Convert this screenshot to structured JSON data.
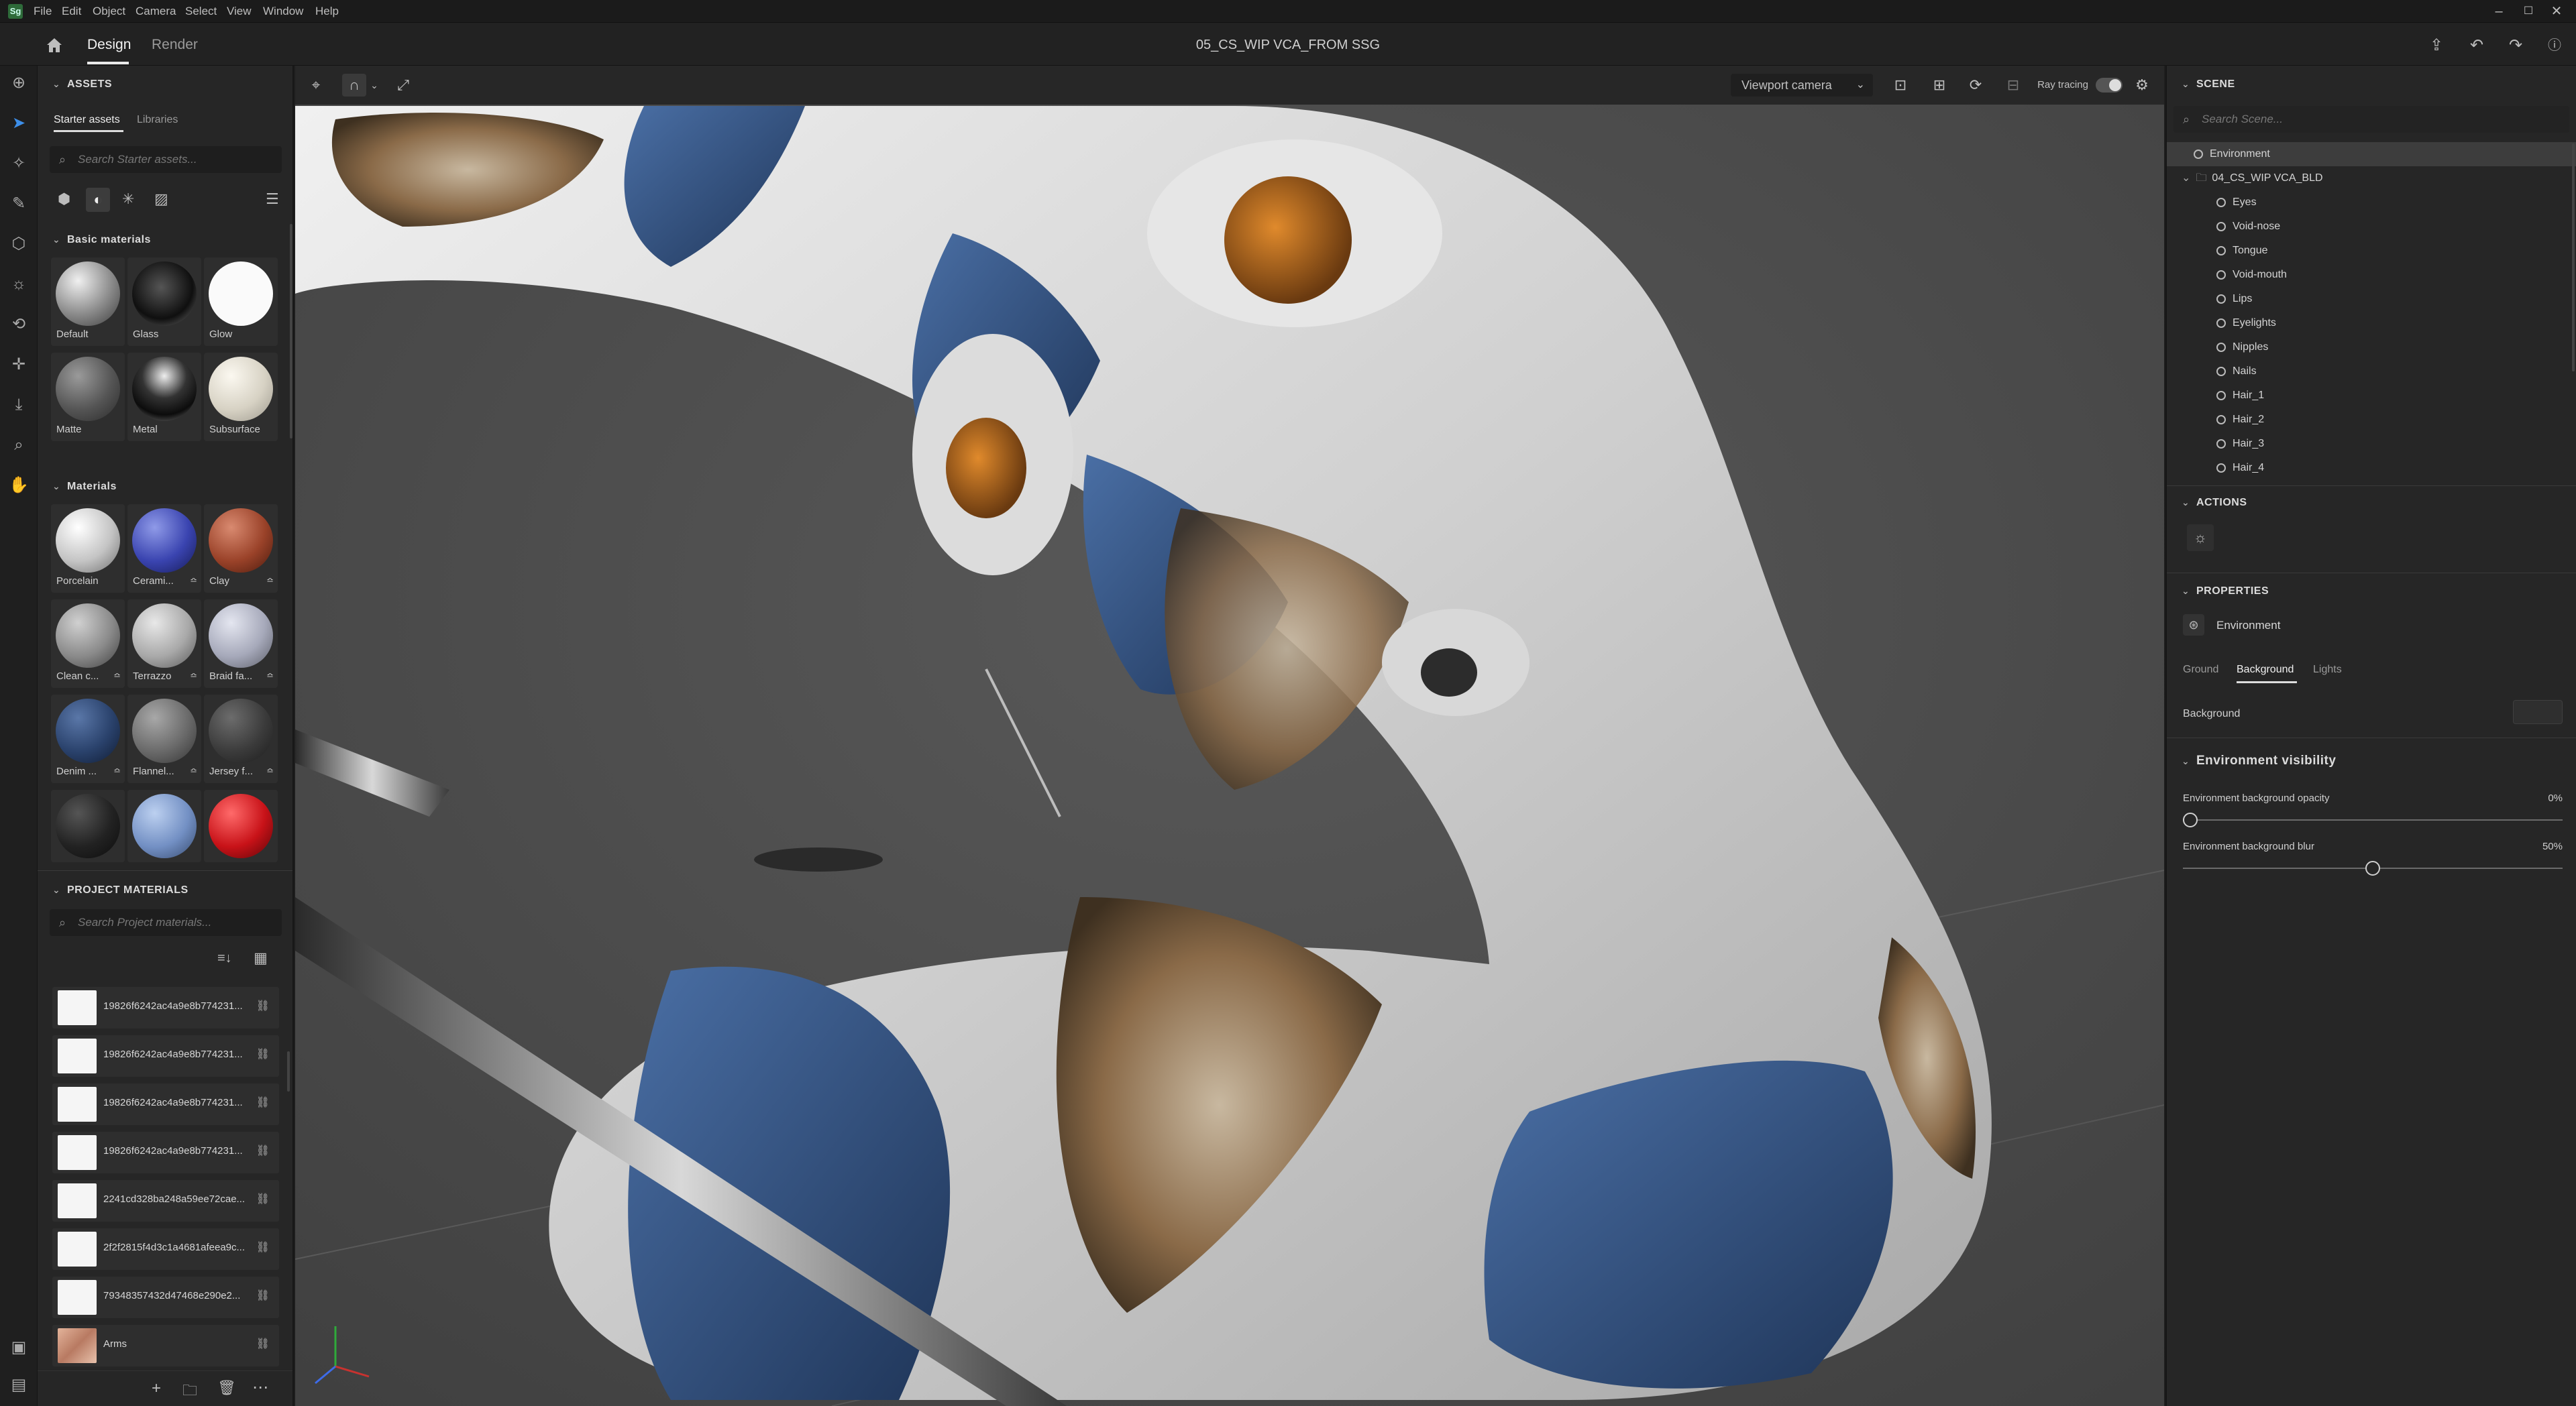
{
  "menubar": {
    "logo": "Sg",
    "items": [
      "File",
      "Edit",
      "Object",
      "Camera",
      "Select",
      "View",
      "Window",
      "Help"
    ]
  },
  "header": {
    "tabs": [
      "Design",
      "Render"
    ],
    "document_title": "05_CS_WIP VCA_FROM SSG"
  },
  "assets": {
    "title": "ASSETS",
    "tabs": [
      "Starter assets",
      "Libraries"
    ],
    "search_placeholder": "Search Starter assets...",
    "basic_title": "Basic materials",
    "basic": [
      "Default",
      "Glass",
      "Glow",
      "Matte",
      "Metal",
      "Subsurface"
    ],
    "materials_title": "Materials",
    "materials": [
      "Porcelain",
      "Cerami...",
      "Clay",
      "Clean c...",
      "Terrazzo",
      "Braid fa...",
      "Denim ...",
      "Flannel...",
      "Jersey f...",
      "",
      "",
      ""
    ],
    "project_title": "PROJECT MATERIALS",
    "project_search_placeholder": "Search Project materials...",
    "project_materials": [
      "19826f6242ac4a9e8b774231...",
      "19826f6242ac4a9e8b774231...",
      "19826f6242ac4a9e8b774231...",
      "19826f6242ac4a9e8b774231...",
      "2241cd328ba248a59ee72cae...",
      "2f2f2815f4d3c1a4681afeea9c...",
      "79348357432d47468e290e2...",
      "Arms"
    ]
  },
  "viewport": {
    "camera": "Viewport camera",
    "ray_tracing_label": "Ray tracing"
  },
  "scene": {
    "title": "SCENE",
    "search_placeholder": "Search Scene...",
    "root": "Environment",
    "group": "04_CS_WIP VCA_BLD",
    "children": [
      "Eyes",
      "Void-nose",
      "Tongue",
      "Void-mouth",
      "Lips",
      "Eyelights",
      "Nipples",
      "Nails",
      "Hair_1",
      "Hair_2",
      "Hair_3",
      "Hair_4"
    ]
  },
  "actions": {
    "title": "ACTIONS"
  },
  "properties": {
    "title": "PROPERTIES",
    "object": "Environment",
    "tabs": [
      "Ground",
      "Background",
      "Lights"
    ],
    "background_label": "Background",
    "env_visibility_title": "Environment visibility",
    "opacity_label": "Environment background opacity",
    "opacity_value": "0%",
    "opacity_fraction": 0,
    "blur_label": "Environment background blur",
    "blur_value": "50%",
    "blur_fraction": 0.5
  },
  "colors": {
    "accent": "#3d8ee8",
    "panel": "#262626",
    "viewport_bg": "#4b4b4b"
  }
}
